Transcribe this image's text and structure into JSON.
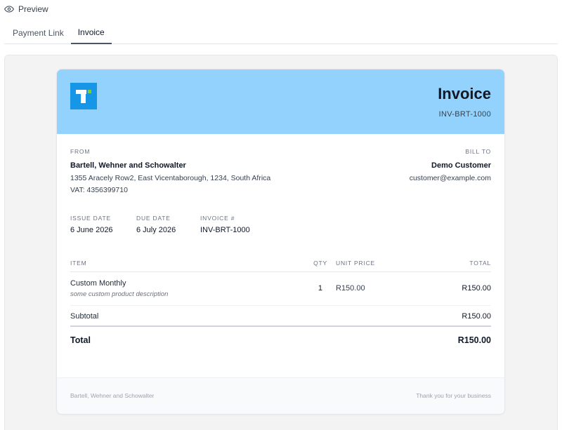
{
  "preview": {
    "label": "Preview",
    "icon": "eye-icon"
  },
  "tabs": [
    {
      "label": "Payment Link",
      "active": false
    },
    {
      "label": "Invoice",
      "active": true
    }
  ],
  "invoice": {
    "title": "Invoice",
    "number": "INV-BRT-1000",
    "colors": {
      "header_bg": "#93d2fc",
      "logo_bg": "#1796e8",
      "logo_accent": "#7ed321"
    },
    "from": {
      "label": "FROM",
      "name": "Bartell, Wehner and Schowalter",
      "address": "1355 Aracely Row2, East Vicentaborough, 1234, South Africa",
      "vat": "VAT: 4356399710"
    },
    "bill_to": {
      "label": "BILL TO",
      "name": "Demo Customer",
      "email": "customer@example.com"
    },
    "meta": [
      {
        "label": "ISSUE DATE",
        "value": "6 June 2026"
      },
      {
        "label": "DUE DATE",
        "value": "6 July 2026"
      },
      {
        "label": "INVOICE #",
        "value": "INV-BRT-1000"
      }
    ],
    "table": {
      "headers": {
        "item": "ITEM",
        "qty": "QTY",
        "unit_price": "UNIT PRICE",
        "total": "TOTAL"
      },
      "rows": [
        {
          "item": "Custom Monthly",
          "description": "some custom product description",
          "qty": "1",
          "unit_price": "R150.00",
          "total": "R150.00"
        }
      ]
    },
    "subtotal": {
      "label": "Subtotal",
      "value": "R150.00"
    },
    "total": {
      "label": "Total",
      "value": "R150.00"
    },
    "footer": {
      "left": "Bartell, Wehner and Schowalter",
      "right": "Thank you for your business"
    }
  }
}
